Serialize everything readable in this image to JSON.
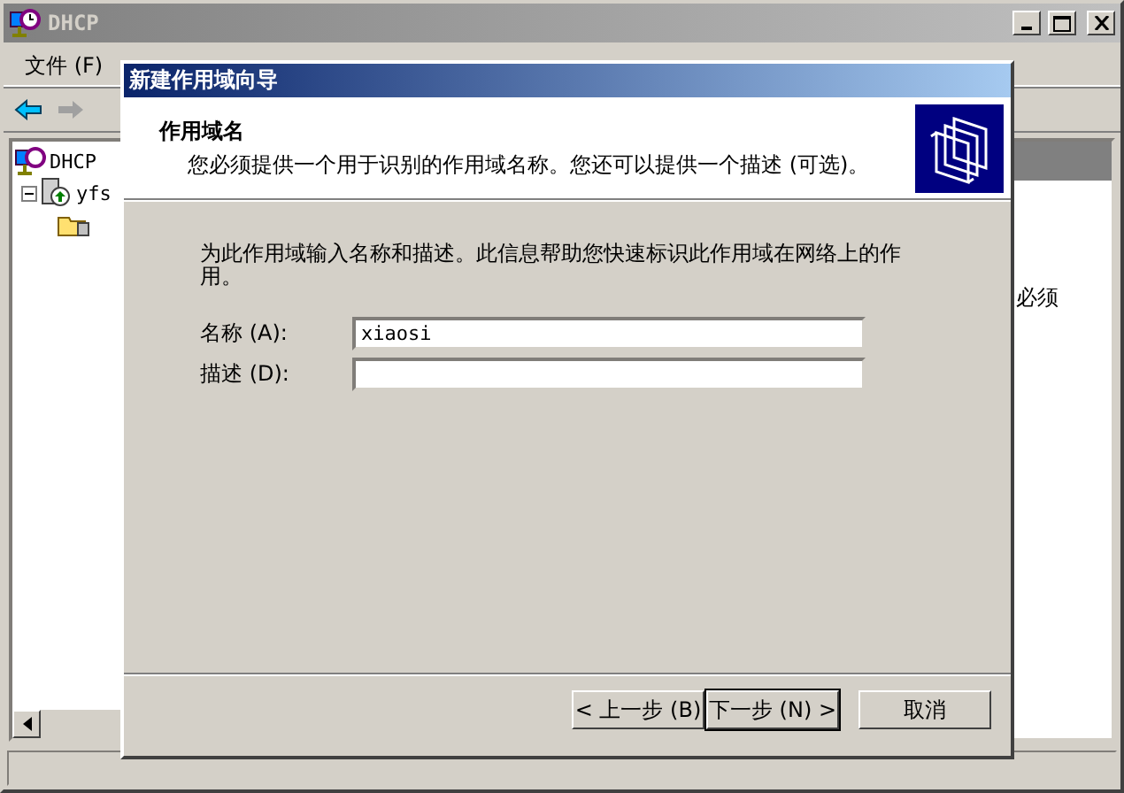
{
  "window": {
    "title": "DHCP",
    "menu": [
      {
        "label": "文件 (F)"
      }
    ],
    "tree": [
      {
        "label": "DHCP",
        "children": [
          {
            "label": "yfs",
            "expanded": true,
            "children": [
              {
                "kind": "scope"
              }
            ]
          }
        ]
      }
    ],
    "right_pane": {
      "text": "必须"
    }
  },
  "dialog": {
    "title": "新建作用域向导",
    "heading": "作用域名",
    "subtitle": "您必须提供一个用于识别的作用域名称。您还可以提供一个描述 (可选)。",
    "intro": "为此作用域输入名称和描述。此信息帮助您快速标识此作用域在网络上的作用。",
    "fields": [
      {
        "label": "名称 (A):",
        "value": "xiaosi"
      },
      {
        "label": "描述 (D):"
      }
    ],
    "buttons": [
      {
        "label": "< 上一步 (B)",
        "default": false
      },
      {
        "label": "下一步 (N) >",
        "default": true
      },
      {
        "label": "取消",
        "default": false
      }
    ]
  }
}
